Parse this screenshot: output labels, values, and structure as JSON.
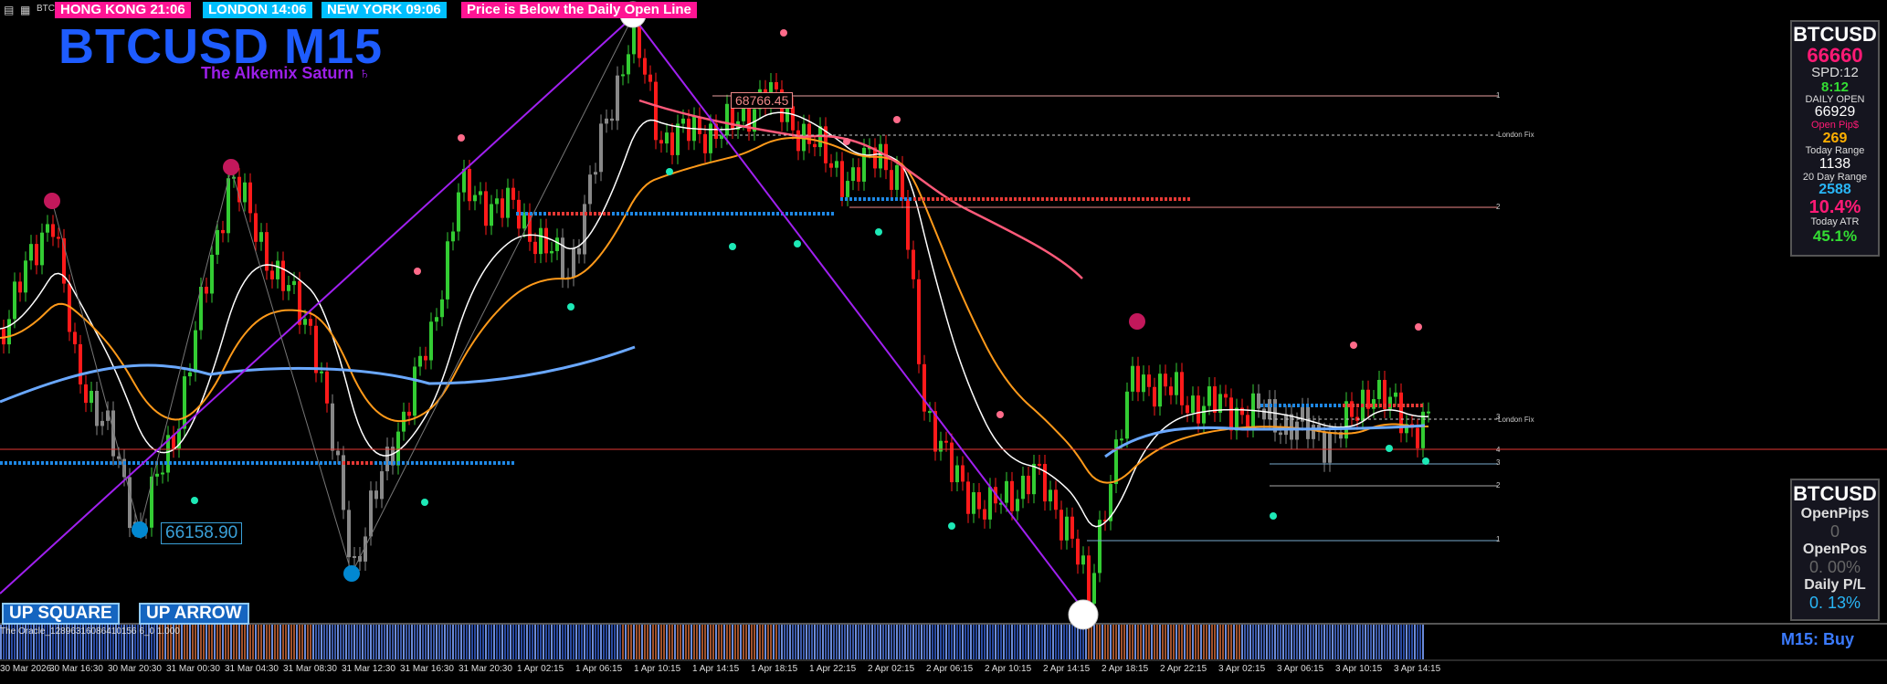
{
  "sessions": {
    "hong_kong": "HONG KONG 21:06",
    "london": "LONDON  14:06",
    "new_york": "NEW YORK   09:06",
    "message": "Price is Below the Daily Open Line"
  },
  "top_label": "BTC",
  "chart_title": "BTCUSD M15",
  "subtitle": "The Alkemix Saturn ♄",
  "price_labels": {
    "low": "66158.90",
    "high": "68766.45"
  },
  "info_panel": {
    "symbol": "BTCUSD",
    "price": "66660",
    "spread": "SPD:12",
    "timer": "8:12",
    "daily_open_label": "DAILY OPEN",
    "daily_open": "66929",
    "open_pips_label": "Open Pip$",
    "open_pips": "269",
    "today_range_label": "Today Range",
    "today_range": "1138",
    "day20_range_label": "20 Day Range",
    "day20_range": "2588",
    "range_pct": "10.4%",
    "today_atr_label": "Today ATR",
    "today_atr": "45.1%"
  },
  "account_panel": {
    "symbol": "BTCUSD",
    "open_pips_label": "OpenPips",
    "open_pips": "0",
    "open_pos_label": "OpenPos",
    "open_pos": "0. 00%",
    "daily_pl_label": "Daily P/L",
    "daily_pl": "0. 13%"
  },
  "buttons": {
    "up_square": "UP SQUARE",
    "up_arrow": "UP ARROW"
  },
  "oracle_label": "The Oracle_12896316086410156 6_0 1.000",
  "signal": "M15: Buy",
  "fib_labels": [
    "London Fix",
    "London Fix",
    "1",
    "2",
    "3",
    "4",
    "2",
    "3",
    "1"
  ],
  "time_axis": [
    "30 Mar 2026",
    "30 Mar 16:30",
    "30 Mar 20:30",
    "31 Mar 00:30",
    "31 Mar 04:30",
    "31 Mar 08:30",
    "31 Mar 12:30",
    "31 Mar 16:30",
    "31 Mar 20:30",
    "1 Apr 02:15",
    "1 Apr 06:15",
    "1 Apr 10:15",
    "1 Apr 14:15",
    "1 Apr 18:15",
    "1 Apr 22:15",
    "2 Apr 02:15",
    "2 Apr 06:15",
    "2 Apr 10:15",
    "2 Apr 14:15",
    "2 Apr 18:15",
    "2 Apr 22:15",
    "3 Apr 02:15",
    "3 Apr 06:15",
    "3 Apr 10:15",
    "3 Apr 14:15"
  ],
  "colors": {
    "bull_candle": "#33cc33",
    "bear_candle": "#ff1a1a",
    "neutral_candle": "#888888",
    "ma_white": "#ffffff",
    "ma_orange": "#ff9a1a",
    "ma_blue": "#6aa8ff",
    "ma_pink": "#ff5a7a",
    "trendline": "#a020f0",
    "dots_cyan": "#1de9b6",
    "dots_pink": "#ff6b8a"
  }
}
